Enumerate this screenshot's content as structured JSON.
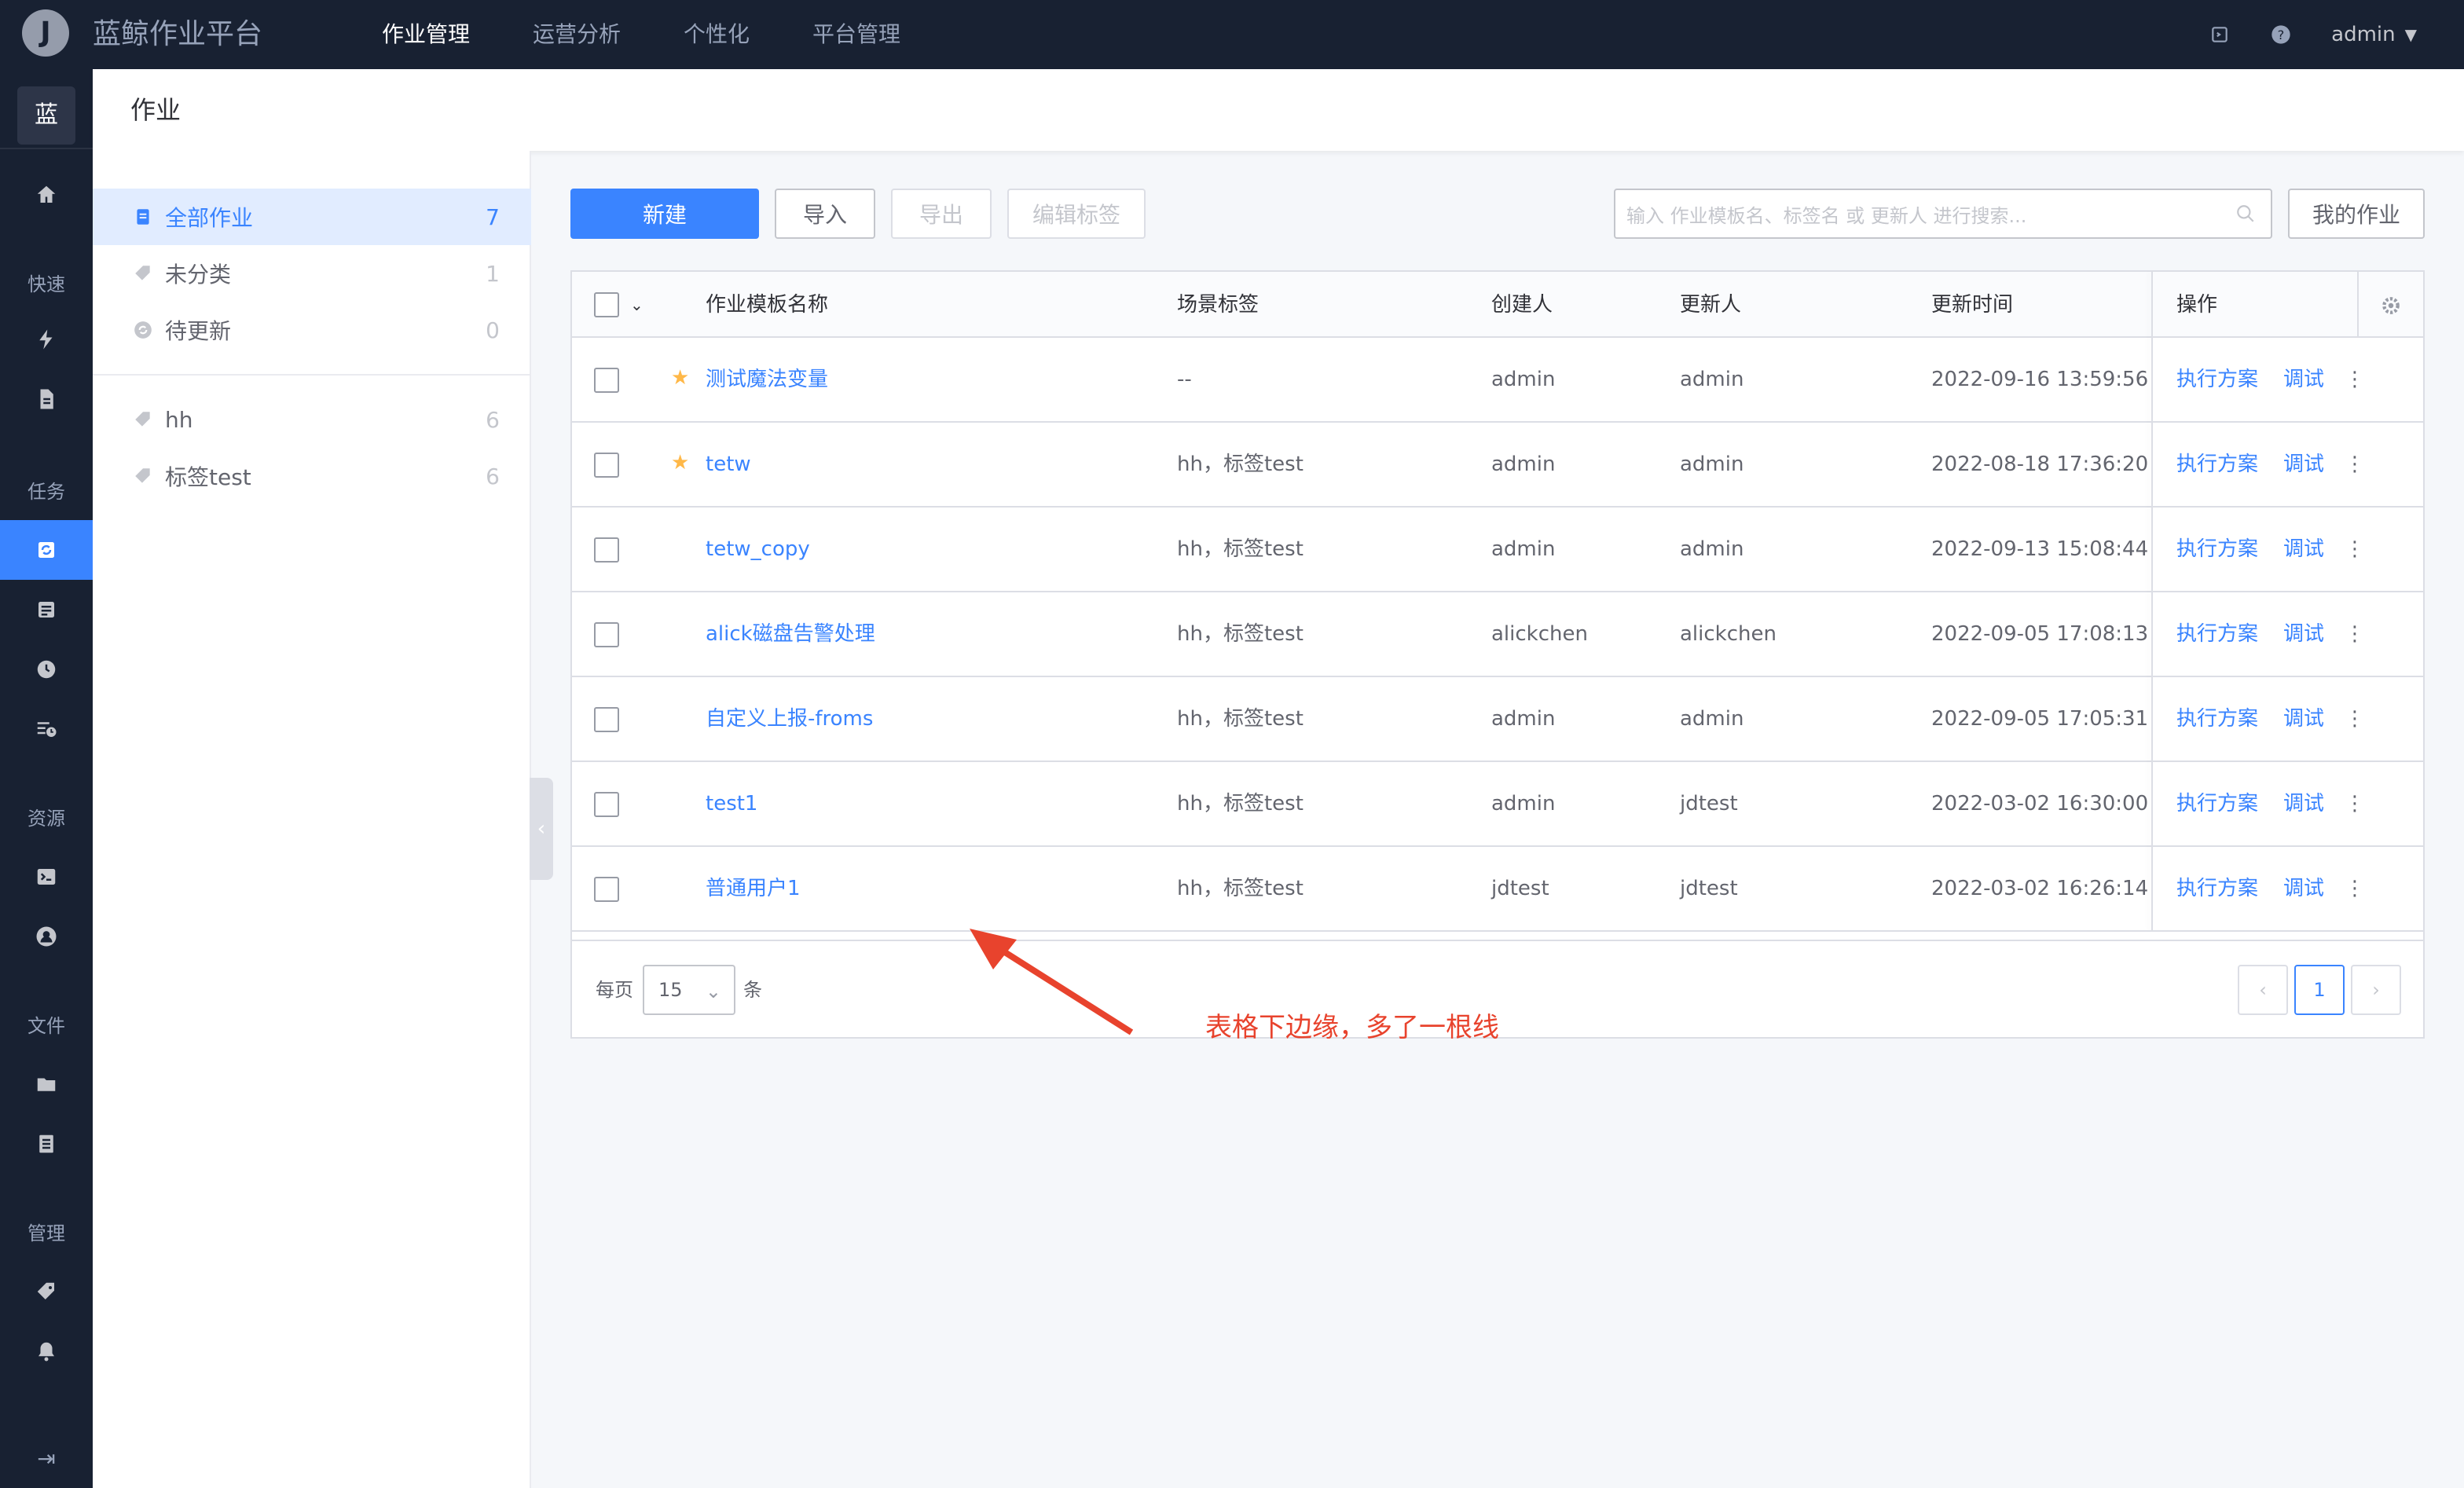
{
  "app": {
    "logo_letter": "J",
    "title": "蓝鲸作业平台",
    "nav": [
      "作业管理",
      "运营分析",
      "个性化",
      "平台管理"
    ],
    "user": "admin"
  },
  "sidebar": {
    "brand": "蓝",
    "groups": {
      "quick": "快速",
      "task": "任务",
      "resource": "资源",
      "file": "文件",
      "manage": "管理"
    }
  },
  "page": {
    "title": "作业"
  },
  "tags": {
    "items": [
      {
        "label": "全部作业",
        "count": "7"
      },
      {
        "label": "未分类",
        "count": "1"
      },
      {
        "label": "待更新",
        "count": "0"
      },
      {
        "label": "hh",
        "count": "6"
      },
      {
        "label": "标签test",
        "count": "6"
      }
    ]
  },
  "toolbar": {
    "new": "新建",
    "import": "导入",
    "export": "导出",
    "edit_tags": "编辑标签",
    "search_placeholder": "输入 作业模板名、标签名 或 更新人 进行搜索...",
    "my_jobs": "我的作业"
  },
  "table": {
    "headers": {
      "name": "作业模板名称",
      "tags": "场景标签",
      "creator": "创建人",
      "updater": "更新人",
      "updated_at": "更新时间",
      "ops": "操作"
    },
    "rows": [
      {
        "name": "测试魔法变量",
        "tags": "--",
        "creator": "admin",
        "updater": "admin",
        "time": "2022-09-16 13:59:56",
        "op1": "执行方案",
        "op2": "调试"
      },
      {
        "name": "tetw",
        "tags": "hh，标签test",
        "creator": "admin",
        "updater": "admin",
        "time": "2022-08-18 17:36:20",
        "op1": "执行方案",
        "op2": "调试"
      },
      {
        "name": "tetw_copy",
        "tags": "hh，标签test",
        "creator": "admin",
        "updater": "admin",
        "time": "2022-09-13 15:08:44",
        "op1": "执行方案",
        "op2": "调试"
      },
      {
        "name": "alick磁盘告警处理",
        "tags": "hh，标签test",
        "creator": "alickchen",
        "updater": "alickchen",
        "time": "2022-09-05 17:08:13",
        "op1": "执行方案",
        "op2": "调试"
      },
      {
        "name": "自定义上报-froms",
        "tags": "hh，标签test",
        "creator": "admin",
        "updater": "admin",
        "time": "2022-09-05 17:05:31",
        "op1": "执行方案",
        "op2": "调试"
      },
      {
        "name": "test1",
        "tags": "hh，标签test",
        "creator": "admin",
        "updater": "jdtest",
        "time": "2022-03-02 16:30:00",
        "op1": "执行方案",
        "op2": "调试"
      },
      {
        "name": "普通用户1",
        "tags": "hh，标签test",
        "creator": "jdtest",
        "updater": "jdtest",
        "time": "2022-03-02 16:26:14",
        "op1": "执行方案",
        "op2": "调试"
      }
    ]
  },
  "pagination": {
    "per_page_label": "每页",
    "per_page_value": "15",
    "unit": "条",
    "current_page": "1"
  },
  "annotation": {
    "text": "表格下边缘，多了一根线"
  },
  "colors": {
    "accent": "#3a84ff",
    "topbar": "#182132",
    "annotation": "#e8432d",
    "star": "#ffb848"
  }
}
